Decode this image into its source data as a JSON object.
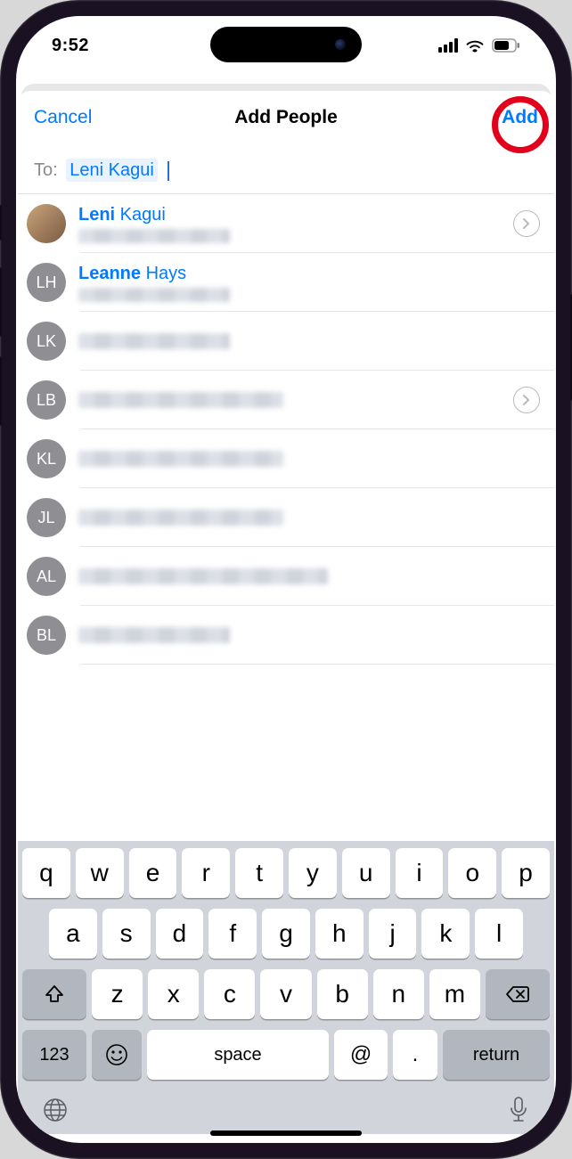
{
  "status": {
    "time": "9:52"
  },
  "nav": {
    "cancel_label": "Cancel",
    "title": "Add People",
    "add_label": "Add"
  },
  "to": {
    "label": "To:",
    "chip": "Leni Kagui"
  },
  "contacts": [
    {
      "initials": "",
      "photo": true,
      "name_match": "Leni",
      "name_rest": " Kagui",
      "sub_blur": "sm",
      "chevron": true
    },
    {
      "initials": "LH",
      "photo": false,
      "name_match": "Leanne",
      "name_rest": " Hays",
      "sub_blur": "sm",
      "chevron": false
    },
    {
      "initials": "LK",
      "photo": false,
      "name_match": "",
      "name_rest": "",
      "blur_name": "sm",
      "chevron": false
    },
    {
      "initials": "LB",
      "photo": false,
      "name_match": "",
      "name_rest": "",
      "blur_name": "md",
      "chevron": true
    },
    {
      "initials": "KL",
      "photo": false,
      "name_match": "",
      "name_rest": "",
      "blur_name": "md",
      "chevron": false
    },
    {
      "initials": "JL",
      "photo": false,
      "name_match": "",
      "name_rest": "",
      "blur_name": "md",
      "chevron": false
    },
    {
      "initials": "AL",
      "photo": false,
      "name_match": "",
      "name_rest": "",
      "blur_name": "lg",
      "chevron": false
    },
    {
      "initials": "BL",
      "photo": false,
      "name_match": "",
      "name_rest": "",
      "blur_name": "sm",
      "chevron": false
    }
  ],
  "keyboard": {
    "row1": [
      "q",
      "w",
      "e",
      "r",
      "t",
      "y",
      "u",
      "i",
      "o",
      "p"
    ],
    "row2": [
      "a",
      "s",
      "d",
      "f",
      "g",
      "h",
      "j",
      "k",
      "l"
    ],
    "row3": [
      "z",
      "x",
      "c",
      "v",
      "b",
      "n",
      "m"
    ],
    "num_label": "123",
    "space_label": "space",
    "at_label": "@",
    "dot_label": ".",
    "return_label": "return"
  }
}
